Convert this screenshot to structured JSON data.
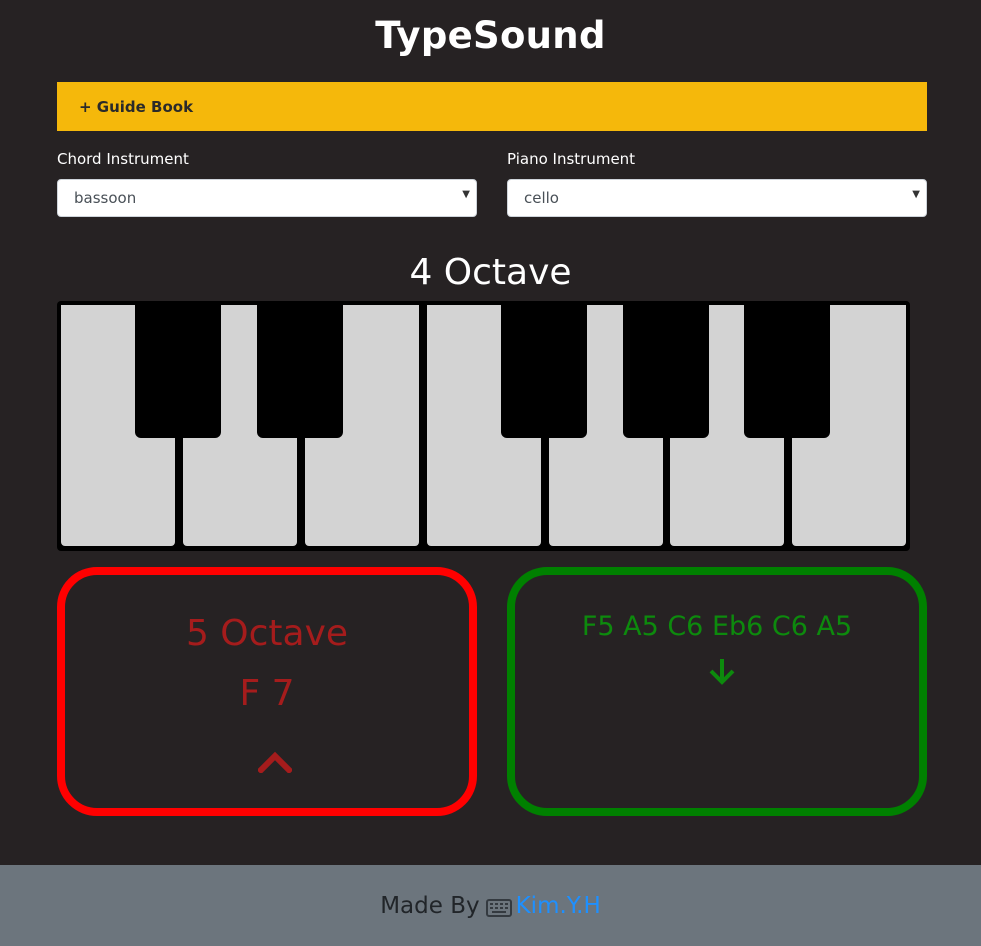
{
  "app": {
    "title": "TypeSound"
  },
  "guide": {
    "label": "+ Guide Book"
  },
  "chord_instrument": {
    "label": "Chord Instrument",
    "selected": "bassoon"
  },
  "piano_instrument": {
    "label": "Piano Instrument",
    "selected": "cello"
  },
  "keyboard": {
    "octave_label": "4 Octave",
    "white_keys": 7,
    "black_key_positions": [
      "C#",
      "D#",
      "F#",
      "G#",
      "A#"
    ]
  },
  "chord_panel": {
    "octave_label": "5 Octave",
    "chord_label": "F 7",
    "icon": "chevron-up-icon",
    "color": "#a51c1c",
    "border_color": "#ff0000"
  },
  "notes_panel": {
    "notes": "F5 A5 C6 Eb6 C6 A5",
    "icon": "arrow-down-icon",
    "color": "#0d8a0d",
    "border_color": "#008000"
  },
  "footer": {
    "made_by": "Made By",
    "icon": "keyboard-icon",
    "author": "Kim.Y.H"
  },
  "colors": {
    "background": "#262223",
    "accent": "#f5b80b",
    "footer_bg": "#6c757d",
    "link": "#1e90ff"
  }
}
